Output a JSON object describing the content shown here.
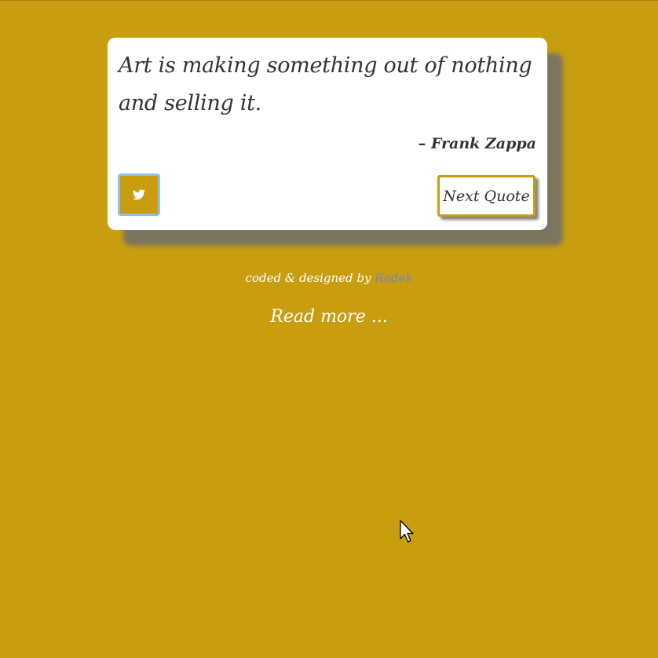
{
  "colors": {
    "page_background": "#c99d10",
    "card_background": "#ffffff",
    "text": "#333333",
    "tweet_button_border": "#8cc2ea",
    "link": "#6f86c8"
  },
  "quote": {
    "text": "Art is making something out of nothing and selling it.",
    "author": "– Frank Zappa"
  },
  "actions": {
    "tweet_icon": "twitter-bird-icon",
    "next_label": "Next Quote"
  },
  "footer": {
    "credits_prefix": "coded & designed by ",
    "credits_link": "Radek",
    "read_more": "Read more ..."
  }
}
